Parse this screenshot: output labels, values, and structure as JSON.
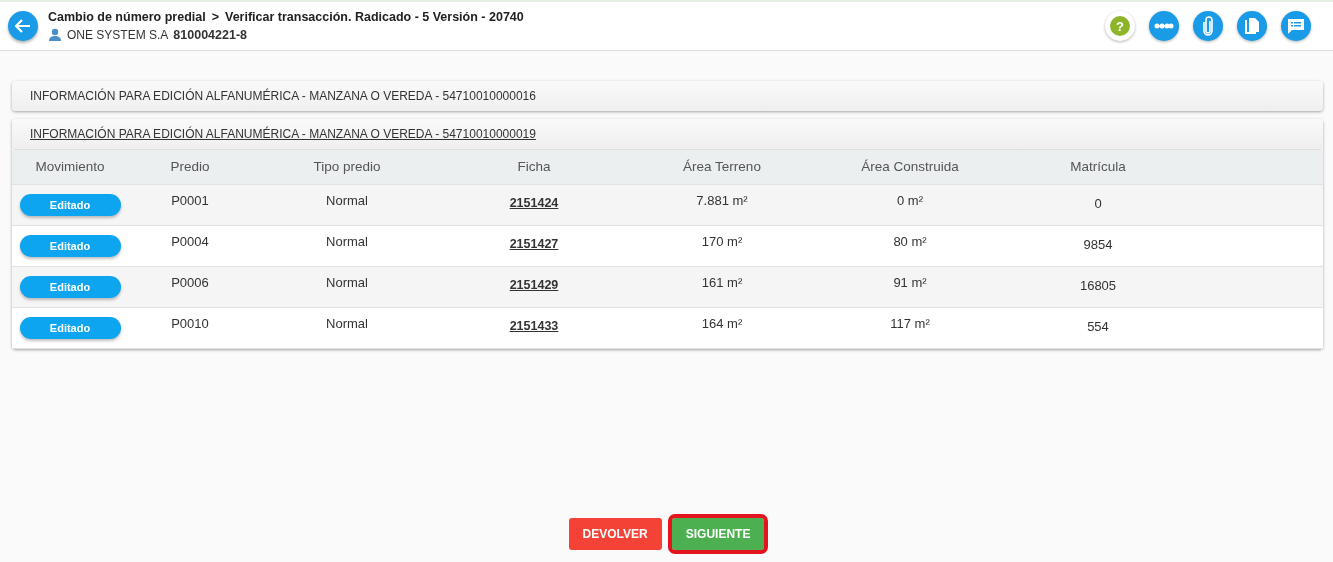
{
  "header": {
    "title": "Cambio de número predial",
    "separator": ">",
    "subtitle": "Verificar transacción. Radicado - 5 Versión - 20740",
    "company": "ONE SYSTEM S.A",
    "nit": "810004221-8"
  },
  "actions": [
    {
      "kind": "help",
      "label": "?"
    },
    {
      "kind": "flow"
    },
    {
      "kind": "attach"
    },
    {
      "kind": "docs"
    },
    {
      "kind": "notes"
    }
  ],
  "sections": [
    {
      "title": "INFORMACIÓN PARA EDICIÓN ALFANUMÉRICA - MANZANA O VEREDA - 54710010000016",
      "expanded": false
    },
    {
      "title": "INFORMACIÓN PARA EDICIÓN ALFANUMÉRICA - MANZANA O VEREDA - 54710010000019",
      "expanded": true,
      "table": {
        "columns": [
          "Movimiento",
          "Predio",
          "Tipo predio",
          "Ficha",
          "Área Terreno",
          "Área Construida",
          "Matrícula"
        ],
        "rows": [
          {
            "movimiento": "Editado",
            "predio": "P0001",
            "tipo": "Normal",
            "ficha": "2151424",
            "terreno": "7.881 m²",
            "construida": "0 m²",
            "matricula": "0"
          },
          {
            "movimiento": "Editado",
            "predio": "P0004",
            "tipo": "Normal",
            "ficha": "2151427",
            "terreno": "170 m²",
            "construida": "80 m²",
            "matricula": "9854"
          },
          {
            "movimiento": "Editado",
            "predio": "P0006",
            "tipo": "Normal",
            "ficha": "2151429",
            "terreno": "161 m²",
            "construida": "91 m²",
            "matricula": "16805"
          },
          {
            "movimiento": "Editado",
            "predio": "P0010",
            "tipo": "Normal",
            "ficha": "2151433",
            "terreno": "164 m²",
            "construida": "117 m²",
            "matricula": "554"
          }
        ]
      }
    }
  ],
  "buttons": [
    {
      "kind": "return",
      "label": "DEVOLVER",
      "highlighted": false
    },
    {
      "kind": "next",
      "label": "SIGUIENTE",
      "highlighted": true
    }
  ]
}
